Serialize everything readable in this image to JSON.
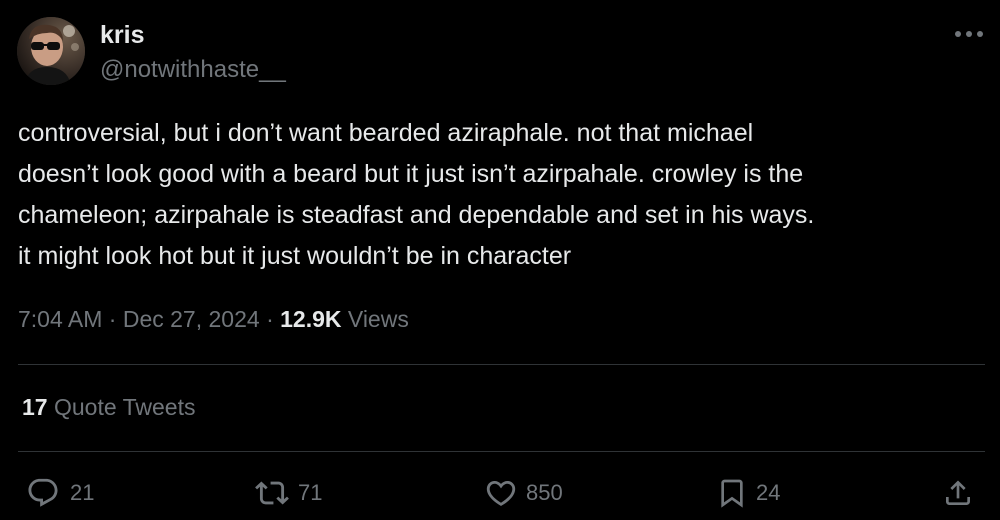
{
  "author": {
    "name": "kris",
    "handle": "@notwithhaste__"
  },
  "tweet": {
    "text": "controversial, but i don’t want bearded aziraphale. not that michael\ndoesn’t look good with a beard but it just isn’t azirpahale. crowley is the\nchameleon; azirpahale is steadfast and dependable and set in his ways.\nit might look hot but it just wouldn’t be in character"
  },
  "meta": {
    "time": "7:04 AM",
    "separator": "·",
    "date": "Dec 27, 2024",
    "views_count": "12.9K",
    "views_label": "Views"
  },
  "quote_tweets": {
    "count": "17",
    "label": "Quote Tweets"
  },
  "actions": {
    "replies": "21",
    "reposts": "71",
    "likes": "850",
    "bookmarks": "24"
  },
  "icons": {
    "more": "more-horizontal-icon",
    "reply": "reply-icon",
    "repost": "repost-icon",
    "like": "heart-icon",
    "bookmark": "bookmark-icon",
    "share": "share-icon"
  },
  "colors": {
    "background": "#000000",
    "text_primary": "#e7e9ea",
    "text_secondary": "#71767b",
    "divider": "#2f3336"
  }
}
